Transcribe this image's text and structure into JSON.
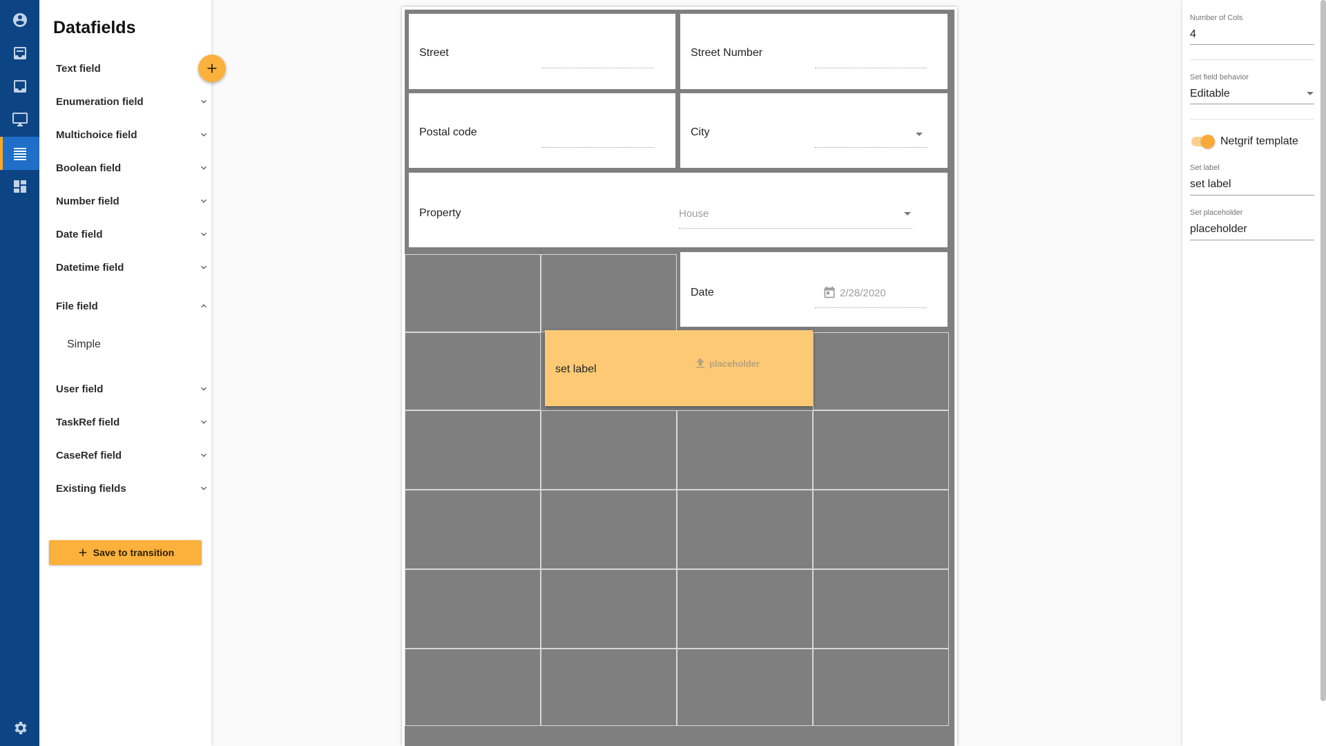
{
  "app": {
    "accent": "#fbb13c",
    "rail_color": "#0d4584"
  },
  "rail": {
    "items": [
      {
        "icon": "account-circle-icon"
      },
      {
        "icon": "inbox-icon"
      },
      {
        "icon": "tray-icon"
      },
      {
        "icon": "desktop-icon"
      },
      {
        "icon": "list-icon",
        "active": true
      },
      {
        "icon": "dashboard-icon"
      },
      {
        "icon": "gear-icon"
      }
    ]
  },
  "datafields": {
    "title": "Datafields",
    "items": [
      {
        "label": "Text field"
      },
      {
        "label": "Enumeration field"
      },
      {
        "label": "Multichoice field"
      },
      {
        "label": "Boolean field"
      },
      {
        "label": "Number field"
      },
      {
        "label": "Date field"
      },
      {
        "label": "Datetime field"
      },
      {
        "label": "File field",
        "expanded": true,
        "sub": [
          "Simple"
        ]
      },
      {
        "label": "User field"
      },
      {
        "label": "TaskRef field"
      },
      {
        "label": "CaseRef field"
      },
      {
        "label": "Existing fields"
      }
    ],
    "save_label": "Save to transition"
  },
  "form": {
    "street": {
      "label": "Street"
    },
    "street_number": {
      "label": "Street Number"
    },
    "postal_code": {
      "label": "Postal code"
    },
    "city": {
      "label": "City"
    },
    "property": {
      "label": "Property",
      "value": "House"
    },
    "date": {
      "label": "Date",
      "value": "2/28/2020"
    },
    "file": {
      "label": "set label",
      "placeholder": "placeholder"
    }
  },
  "properties": {
    "cols_label": "Number of Cols",
    "cols_value": "4",
    "behavior_label": "Set field behavior",
    "behavior_value": "Editable",
    "template_label": "Netgrif template",
    "template_on": true,
    "set_label_label": "Set label",
    "set_label_value": "set label",
    "set_placeholder_label": "Set placeholder",
    "set_placeholder_value": "placeholder"
  }
}
